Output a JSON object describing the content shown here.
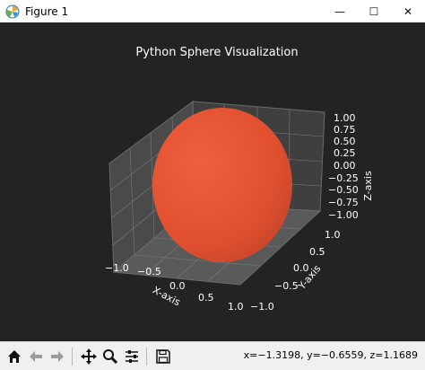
{
  "window": {
    "title": "Figure 1",
    "minimize_glyph": "—",
    "maximize_glyph": "☐",
    "close_glyph": "✕"
  },
  "plot": {
    "title": "Python Sphere Visualization",
    "x_label": "X-axis",
    "y_label": "Y-axis",
    "z_label": "Z-axis",
    "x_ticks": [
      "−1.0",
      "−0.5",
      "0.0",
      "0.5",
      "1.0"
    ],
    "y_ticks": [
      "−1.0",
      "−0.5",
      "0.0",
      "0.5",
      "1.0"
    ],
    "z_ticks": [
      "1.00",
      "0.75",
      "0.50",
      "0.25",
      "0.00",
      "−0.25",
      "−0.50",
      "−0.75",
      "−1.00"
    ],
    "sphere_color": "#e8553a",
    "background_color": "#232323"
  },
  "toolbar": {
    "buttons": [
      "home-icon",
      "back-icon",
      "forward-icon",
      "pan-icon",
      "zoom-icon",
      "configure-icon",
      "save-icon"
    ],
    "coords_text": "x=−1.3198, y=−0.6559, z=1.1689"
  }
}
